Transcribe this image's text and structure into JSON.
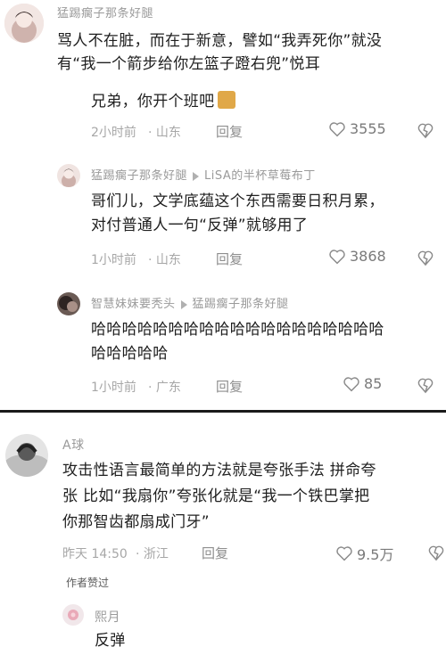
{
  "thread1": {
    "main": {
      "username": "猛踢瘸子那条好腿",
      "text_lines": [
        "骂人不在脏，而在于新意，譬如“我弄死你”就没",
        "有“我一个箭步给你左篮子蹬右兜”悦耳"
      ]
    },
    "reply1": {
      "text": "兄弟，你开个班吧",
      "sticker_icon": "emoji-sticker-icon",
      "time": "2小时前",
      "location": "山东",
      "reply_label": "回复",
      "likes": "3555"
    },
    "reply2": {
      "username": "猛踢瘸子那条好腿",
      "reply_to": "LiSA的半杯草莓布丁",
      "text_lines": [
        "哥们儿，文学底蕴这个东西需要日积月累，",
        "对付普通人一句“反弹”就够用了"
      ],
      "time": "1小时前",
      "location": "山东",
      "reply_label": "回复",
      "likes": "3868"
    },
    "reply3": {
      "username": "智慧妹妹要秃头",
      "reply_to": "猛踢瘸子那条好腿",
      "text_lines": [
        "哈哈哈哈哈哈哈哈哈哈哈哈哈哈哈哈哈哈哈",
        "哈哈哈哈哈"
      ],
      "time": "1小时前",
      "location": "广东",
      "reply_label": "回复",
      "likes": "85"
    }
  },
  "thread2": {
    "main": {
      "username": "A球",
      "text_lines": [
        "攻击性语言最简单的方法就是夸张手法 拼命夸",
        "张 比如“我扇你”夸张化就是“我一个铁巴掌把",
        "你那智齿都扇成门牙”"
      ],
      "time": "昨天 14:50",
      "location": "浙江",
      "reply_label": "回复",
      "likes": "9.5万",
      "author_liked": "作者赞过"
    },
    "reply1": {
      "username": "熙月",
      "text": "反弹"
    }
  },
  "colors": {
    "muted": "#9a9a9a",
    "text": "#202020",
    "divider": "#1a1a1a"
  }
}
